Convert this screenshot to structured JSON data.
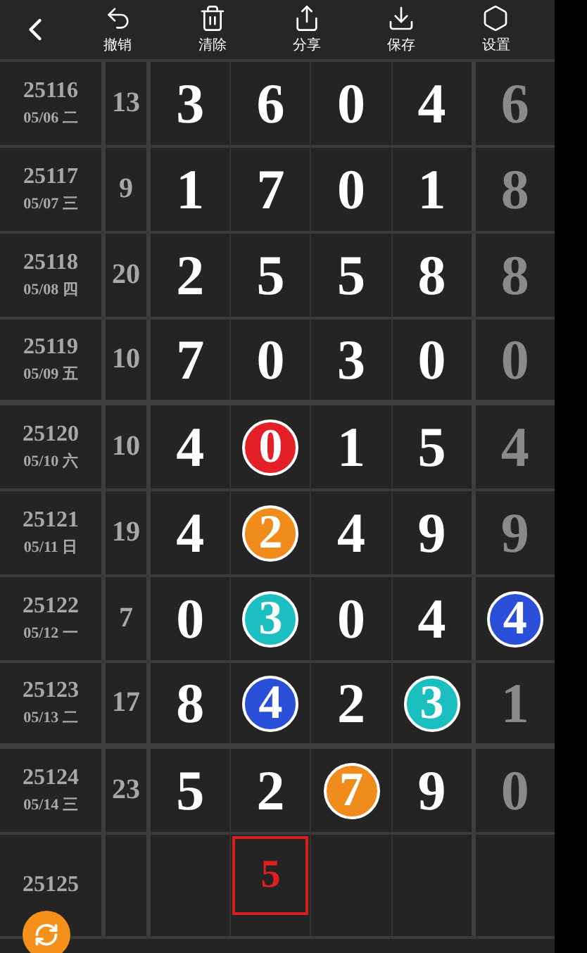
{
  "toolbar": {
    "actions": [
      {
        "label": "撤销",
        "kind": "undo"
      },
      {
        "label": "清除",
        "kind": "trash"
      },
      {
        "label": "分享",
        "kind": "share"
      },
      {
        "label": "保存",
        "kind": "save"
      },
      {
        "label": "设置",
        "kind": "settings"
      }
    ]
  },
  "rows": [
    {
      "issue": "25116",
      "date": "05/06 二",
      "sum": "13",
      "group_end": false,
      "cells": [
        {
          "kind": "plain",
          "value": "3"
        },
        {
          "kind": "plain",
          "value": "6"
        },
        {
          "kind": "plain",
          "value": "0"
        },
        {
          "kind": "plain",
          "value": "4"
        },
        {
          "kind": "dim",
          "value": "6"
        }
      ]
    },
    {
      "issue": "25117",
      "date": "05/07 三",
      "sum": "9",
      "group_end": false,
      "cells": [
        {
          "kind": "plain",
          "value": "1"
        },
        {
          "kind": "plain",
          "value": "7"
        },
        {
          "kind": "plain",
          "value": "0"
        },
        {
          "kind": "plain",
          "value": "1"
        },
        {
          "kind": "dim",
          "value": "8"
        }
      ]
    },
    {
      "issue": "25118",
      "date": "05/08 四",
      "sum": "20",
      "group_end": false,
      "cells": [
        {
          "kind": "plain",
          "value": "2"
        },
        {
          "kind": "plain",
          "value": "5"
        },
        {
          "kind": "plain",
          "value": "5"
        },
        {
          "kind": "plain",
          "value": "8"
        },
        {
          "kind": "dim",
          "value": "8"
        }
      ]
    },
    {
      "issue": "25119",
      "date": "05/09 五",
      "sum": "10",
      "group_end": true,
      "cells": [
        {
          "kind": "plain",
          "value": "7"
        },
        {
          "kind": "plain",
          "value": "0"
        },
        {
          "kind": "plain",
          "value": "3"
        },
        {
          "kind": "plain",
          "value": "0"
        },
        {
          "kind": "dim",
          "value": "0"
        }
      ]
    },
    {
      "issue": "25120",
      "date": "05/10 六",
      "sum": "10",
      "group_end": false,
      "cells": [
        {
          "kind": "plain",
          "value": "4"
        },
        {
          "kind": "ball",
          "value": "0",
          "color": "#e32028"
        },
        {
          "kind": "plain",
          "value": "1"
        },
        {
          "kind": "plain",
          "value": "5"
        },
        {
          "kind": "dim",
          "value": "4"
        }
      ]
    },
    {
      "issue": "25121",
      "date": "05/11 日",
      "sum": "19",
      "group_end": false,
      "cells": [
        {
          "kind": "plain",
          "value": "4"
        },
        {
          "kind": "ball",
          "value": "2",
          "color": "#f08c1c"
        },
        {
          "kind": "plain",
          "value": "4"
        },
        {
          "kind": "plain",
          "value": "9"
        },
        {
          "kind": "dim",
          "value": "9"
        }
      ]
    },
    {
      "issue": "25122",
      "date": "05/12 一",
      "sum": "7",
      "group_end": false,
      "cells": [
        {
          "kind": "plain",
          "value": "0"
        },
        {
          "kind": "ball",
          "value": "3",
          "color": "#1cbfbf"
        },
        {
          "kind": "plain",
          "value": "0"
        },
        {
          "kind": "plain",
          "value": "4"
        },
        {
          "kind": "ball",
          "value": "4",
          "color": "#2a4fd8"
        }
      ]
    },
    {
      "issue": "25123",
      "date": "05/13 二",
      "sum": "17",
      "group_end": true,
      "cells": [
        {
          "kind": "plain",
          "value": "8"
        },
        {
          "kind": "ball",
          "value": "4",
          "color": "#2a4fd8"
        },
        {
          "kind": "plain",
          "value": "2"
        },
        {
          "kind": "ball",
          "value": "3",
          "color": "#1cbfbf"
        },
        {
          "kind": "dim",
          "value": "1"
        }
      ]
    },
    {
      "issue": "25124",
      "date": "05/14 三",
      "sum": "23",
      "group_end": false,
      "cells": [
        {
          "kind": "plain",
          "value": "5"
        },
        {
          "kind": "plain",
          "value": "2"
        },
        {
          "kind": "ball",
          "value": "7",
          "color": "#f08c1c"
        },
        {
          "kind": "plain",
          "value": "9"
        },
        {
          "kind": "dim",
          "value": "0"
        }
      ]
    },
    {
      "issue": "25125",
      "cells": [
        {
          "kind": "empty"
        },
        {
          "kind": "input",
          "value": "5"
        },
        {
          "kind": "empty"
        },
        {
          "kind": "empty"
        },
        {
          "kind": "empty"
        }
      ]
    }
  ]
}
